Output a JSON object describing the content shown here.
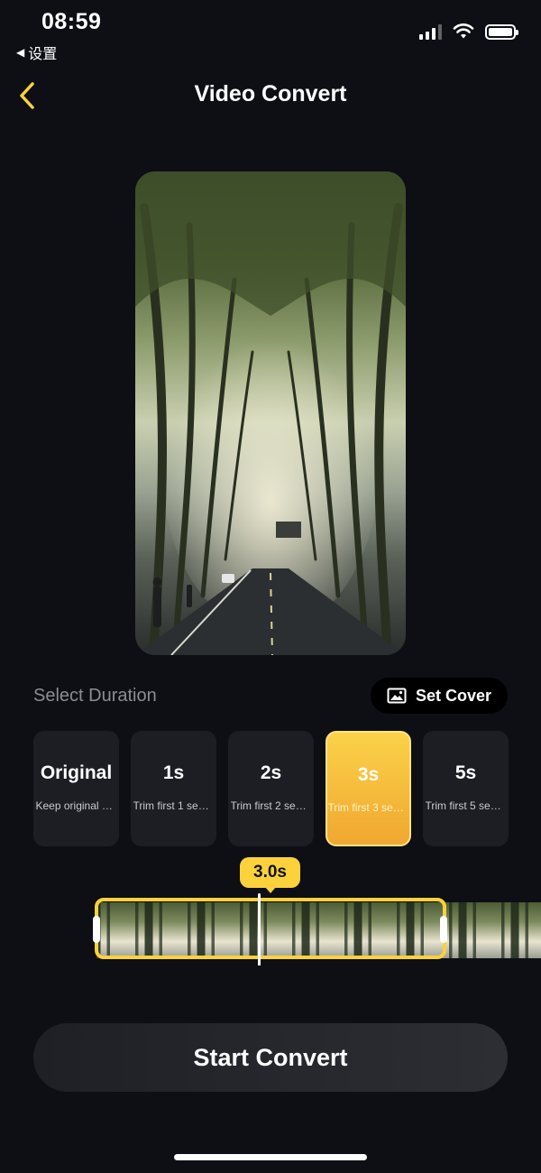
{
  "status_bar": {
    "time": "08:59",
    "back_label": "设置",
    "back_glyph": "◀"
  },
  "nav": {
    "title": "Video Convert"
  },
  "duration": {
    "label": "Select Duration",
    "set_cover_label": "Set Cover",
    "options": [
      {
        "title": "Original",
        "subtitle": "Keep original duration",
        "selected": false
      },
      {
        "title": "1s",
        "subtitle": "Trim first 1 second",
        "selected": false
      },
      {
        "title": "2s",
        "subtitle": "Trim first 2 seconds",
        "selected": false
      },
      {
        "title": "3s",
        "subtitle": "Trim first 3 seconds",
        "selected": true
      },
      {
        "title": "5s",
        "subtitle": "Trim first 5 seconds",
        "selected": false
      }
    ]
  },
  "trim": {
    "badge": "3.0s"
  },
  "actions": {
    "start_label": "Start Convert"
  },
  "colors": {
    "accent": "#fbd23c",
    "background": "#0d0f14",
    "card": "#1c1e24"
  },
  "icons": [
    "cellular-signal-icon",
    "wifi-icon",
    "battery-icon",
    "chevron-left-icon",
    "image-icon"
  ]
}
